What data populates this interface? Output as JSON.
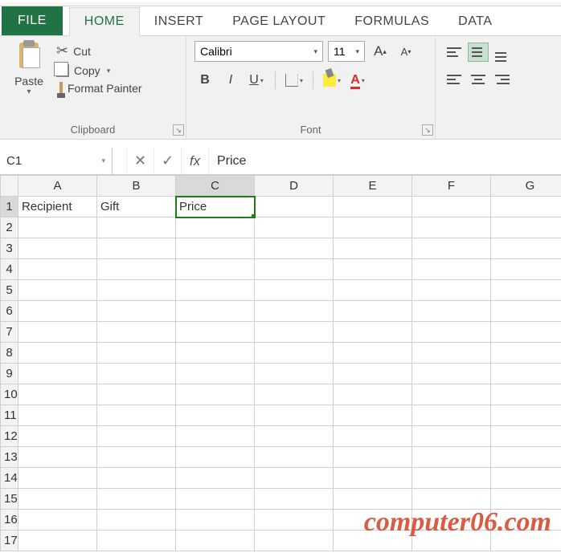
{
  "tabs": {
    "file": "FILE",
    "home": "HOME",
    "insert": "INSERT",
    "page_layout": "PAGE LAYOUT",
    "formulas": "FORMULAS",
    "data": "DATA"
  },
  "clipboard": {
    "paste": "Paste",
    "cut": "Cut",
    "copy": "Copy",
    "format_painter": "Format Painter",
    "group_label": "Clipboard"
  },
  "font": {
    "name": "Calibri",
    "size": "11",
    "increase_label": "A",
    "decrease_label": "A",
    "bold": "B",
    "italic": "I",
    "underline": "U",
    "group_label": "Font"
  },
  "name_box": "C1",
  "formula_bar": {
    "fx": "fx",
    "value": "Price"
  },
  "columns": [
    "A",
    "B",
    "C",
    "D",
    "E",
    "F",
    "G"
  ],
  "rows": [
    "1",
    "2",
    "3",
    "4",
    "5",
    "6",
    "7",
    "8",
    "9",
    "10",
    "11",
    "12",
    "13",
    "14",
    "15",
    "16",
    "17"
  ],
  "cells": {
    "A1": "Recipient",
    "B1": "Gift",
    "C1": "Price"
  },
  "selected_cell": "C1",
  "watermark": "computer06.com"
}
